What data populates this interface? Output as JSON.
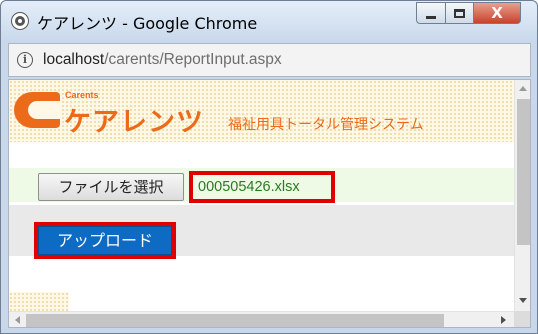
{
  "window": {
    "title": "ケアレンツ - Google Chrome",
    "close_glyph": "X",
    "icons": [
      "chrome-icon",
      "minimize-icon",
      "maximize-icon",
      "close-icon"
    ]
  },
  "address": {
    "info_glyph": "i",
    "host": "localhost",
    "path": "/carents/ReportInput.aspx"
  },
  "page": {
    "logo": {
      "carents": "Carents",
      "name": "ケアレンツ",
      "tagline": "福祉用具トータル管理システム"
    },
    "file_button_label": "ファイルを選択",
    "selected_file": "000505426.xlsx",
    "upload_label": "アップロード"
  },
  "colors": {
    "brand_orange": "#ec6b1a",
    "highlight_red": "#e00000",
    "upload_blue": "#0e6bc4",
    "filename_green": "#2b7a1f"
  }
}
